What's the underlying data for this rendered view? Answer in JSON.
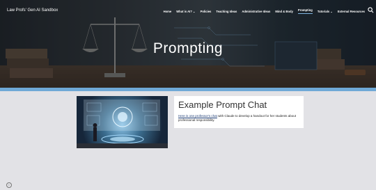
{
  "site": {
    "title": "Law Profs' Gen AI Sandbox"
  },
  "nav": {
    "items": [
      {
        "label": "Home"
      },
      {
        "label": "What is AI? ⌄"
      },
      {
        "label": "Policies"
      },
      {
        "label": "Teaching Ideas"
      },
      {
        "label": "Administrative Ideas"
      },
      {
        "label": "Mind & Body"
      },
      {
        "label": "Prompting"
      },
      {
        "label": "Tutorials ⌄"
      },
      {
        "label": "External Resources"
      }
    ],
    "active": "Prompting"
  },
  "hero": {
    "heading": "Prompting"
  },
  "card": {
    "title": "Example Prompt Chat",
    "link_text": "Here is one professor's chat",
    "body_rest": " with Claude to develop a handout for her students about professional responsibility."
  },
  "colors": {
    "accent": "#6fa9d6",
    "link": "#1a3a73"
  }
}
